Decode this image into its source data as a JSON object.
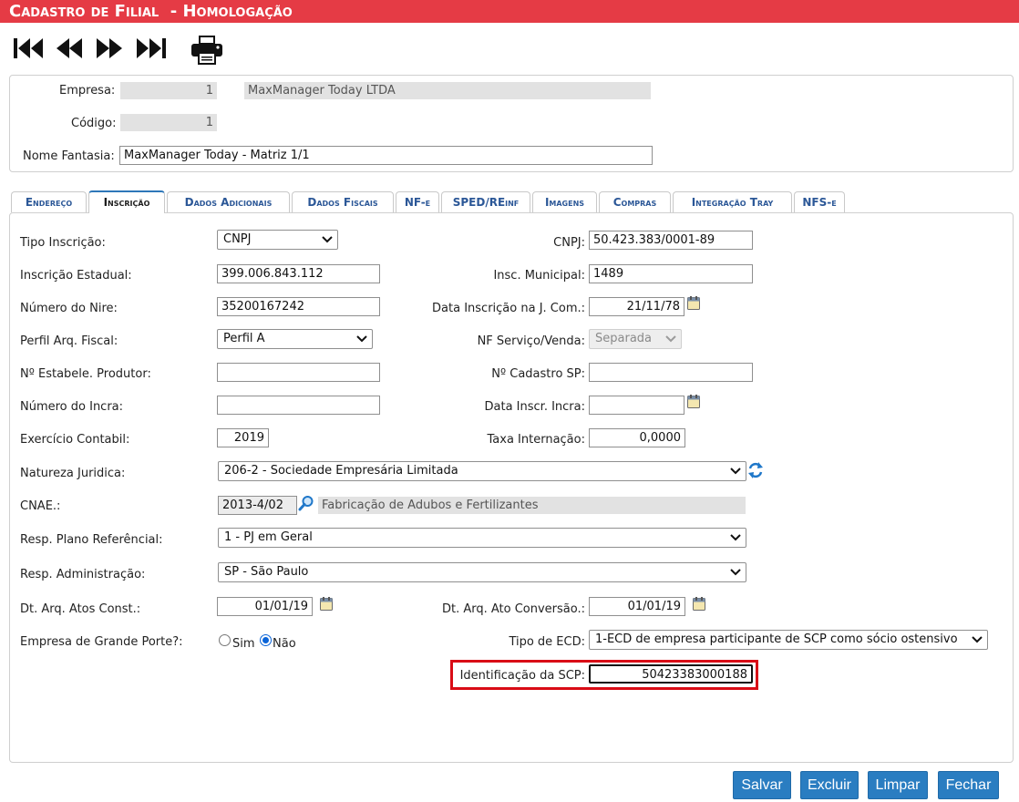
{
  "window": {
    "title": "Cadastro de Filial  - Homologação"
  },
  "toolbar": {
    "icons": [
      "first-record-icon",
      "previous-record-icon",
      "next-record-icon",
      "last-record-icon",
      "print-icon"
    ]
  },
  "header": {
    "empresa_label": "Empresa:",
    "empresa_code": "1",
    "empresa_name": "MaxManager Today LTDA",
    "codigo_label": "Código:",
    "codigo_value": "1",
    "nome_fantasia_label": "Nome Fantasia:",
    "nome_fantasia_value": "MaxManager Today - Matriz 1/1"
  },
  "tabs": [
    {
      "label": "Endereço"
    },
    {
      "label": "Inscrição",
      "active": true
    },
    {
      "label": "Dados Adicionais"
    },
    {
      "label": "Dados Fiscais"
    },
    {
      "label": "NF-e"
    },
    {
      "label": "SPED/REinf"
    },
    {
      "label": "Imagens"
    },
    {
      "label": "Compras"
    },
    {
      "label": "Integração Tray"
    },
    {
      "label": "NFS-e"
    }
  ],
  "form": {
    "tipo_inscricao": {
      "label": "Tipo Inscrição:",
      "value": "CNPJ"
    },
    "cnpj": {
      "label": "CNPJ:",
      "value": "50.423.383/0001-89"
    },
    "inscricao_estadual": {
      "label": "Inscrição Estadual:",
      "value": "399.006.843.112"
    },
    "insc_municipal": {
      "label": "Insc. Municipal:",
      "value": "1489"
    },
    "numero_nire": {
      "label": "Número do Nire:",
      "value": "35200167242"
    },
    "data_inscricao_jcom": {
      "label": "Data Inscrição na J. Com.:",
      "value": "21/11/78"
    },
    "perfil_arq_fiscal": {
      "label": "Perfil Arq. Fiscal:",
      "value": "Perfil A"
    },
    "nf_servico_venda": {
      "label": "NF Serviço/Venda:",
      "value": "Separada"
    },
    "estabele_produtor": {
      "label": "Nº Estabele. Produtor:",
      "value": ""
    },
    "cadastro_sp": {
      "label": "Nº Cadastro SP:",
      "value": ""
    },
    "numero_incra": {
      "label": "Número do Incra:",
      "value": ""
    },
    "data_inscr_incra": {
      "label": "Data Inscr. Incra:",
      "value": ""
    },
    "exercicio_contabil": {
      "label": "Exercício Contabil:",
      "value": "2019"
    },
    "taxa_internacao": {
      "label": "Taxa Internação:",
      "value": "0,0000"
    },
    "natureza_juridica": {
      "label": "Natureza Juridica:",
      "value": "206-2 - Sociedade Empresária Limitada"
    },
    "cnae": {
      "label": "CNAE.:",
      "code": "2013-4/02",
      "description": "Fabricação de Adubos e Fertilizantes"
    },
    "resp_plano_referencial": {
      "label": "Resp. Plano Referêncial:",
      "value": "1 - PJ em Geral"
    },
    "resp_administracao": {
      "label": "Resp. Administração:",
      "value": "SP - São Paulo"
    },
    "dt_arq_atos_const": {
      "label": "Dt. Arq. Atos Const.:",
      "value": "01/01/19"
    },
    "dt_arq_ato_conversao": {
      "label": "Dt. Arq. Ato Conversão.:",
      "value": "01/01/19"
    },
    "grande_porte": {
      "label": "Empresa de Grande Porte?:",
      "option_sim": "Sim",
      "option_nao": "Não",
      "selected": "Não"
    },
    "tipo_ecd": {
      "label": "Tipo de ECD:",
      "value": "1-ECD de empresa participante de SCP como sócio ostensivo"
    },
    "identificacao_scp": {
      "label": "Identificação da SCP:",
      "value": "50423383000188"
    }
  },
  "buttons": {
    "salvar": "Salvar",
    "excluir": "Excluir",
    "limpar": "Limpar",
    "fechar": "Fechar"
  },
  "colors": {
    "title_bar": "#e53b45",
    "accent": "#2a7dc1",
    "highlight_border": "#d90c16"
  }
}
